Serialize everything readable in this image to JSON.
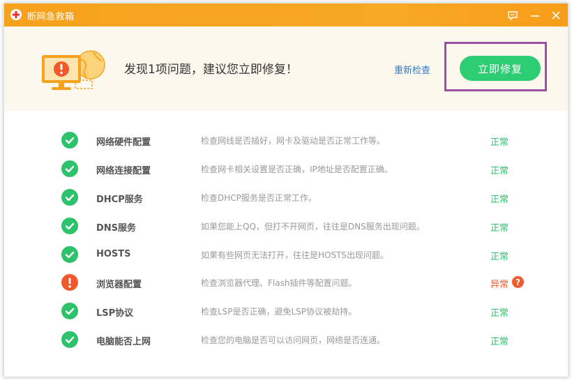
{
  "window": {
    "title": "断网急救箱",
    "controls": {
      "feedback": "feedback-icon",
      "minimize": "minimize-icon",
      "close": "close-icon"
    }
  },
  "banner": {
    "headline": "发现1项问题，建议您立即修复！",
    "recheck_label": "重新检查",
    "fix_label": "立即修复"
  },
  "checks": [
    {
      "name": "网络硬件配置",
      "desc": "检查网线是否插好，网卡及驱动是否正常工作等。",
      "status": "正常",
      "state": "ok"
    },
    {
      "name": "网络连接配置",
      "desc": "检查网卡相关设置是否正确，IP地址是否配置正确。",
      "status": "正常",
      "state": "ok"
    },
    {
      "name": "DHCP服务",
      "desc": "检查DHCP服务是否正常工作。",
      "status": "正常",
      "state": "ok"
    },
    {
      "name": "DNS服务",
      "desc": "如果您能上QQ，但打不开网页，往往是DNS服务出现问题。",
      "status": "正常",
      "state": "ok"
    },
    {
      "name": "HOSTS",
      "desc": "如果有些网页无法打开，往往是HOSTS出现问题。",
      "status": "正常",
      "state": "ok"
    },
    {
      "name": "浏览器配置",
      "desc": "检查浏览器代理、Flash插件等配置问题。",
      "status": "异常",
      "state": "error",
      "help": "?"
    },
    {
      "name": "LSP协议",
      "desc": "检查LSP是否正确，避免LSP协议被劫持。",
      "status": "正常",
      "state": "ok"
    },
    {
      "name": "电脑能否上网",
      "desc": "检查您的电脑是否可以访问网页，网络是否连通。",
      "status": "正常",
      "state": "ok"
    }
  ],
  "colors": {
    "titlebar": "#f8a825",
    "ok": "#2dc26b",
    "error": "#f05a2b",
    "fix_button": "#2dcd73",
    "highlight_frame": "#9b4fa5",
    "link": "#2a7bd5"
  }
}
